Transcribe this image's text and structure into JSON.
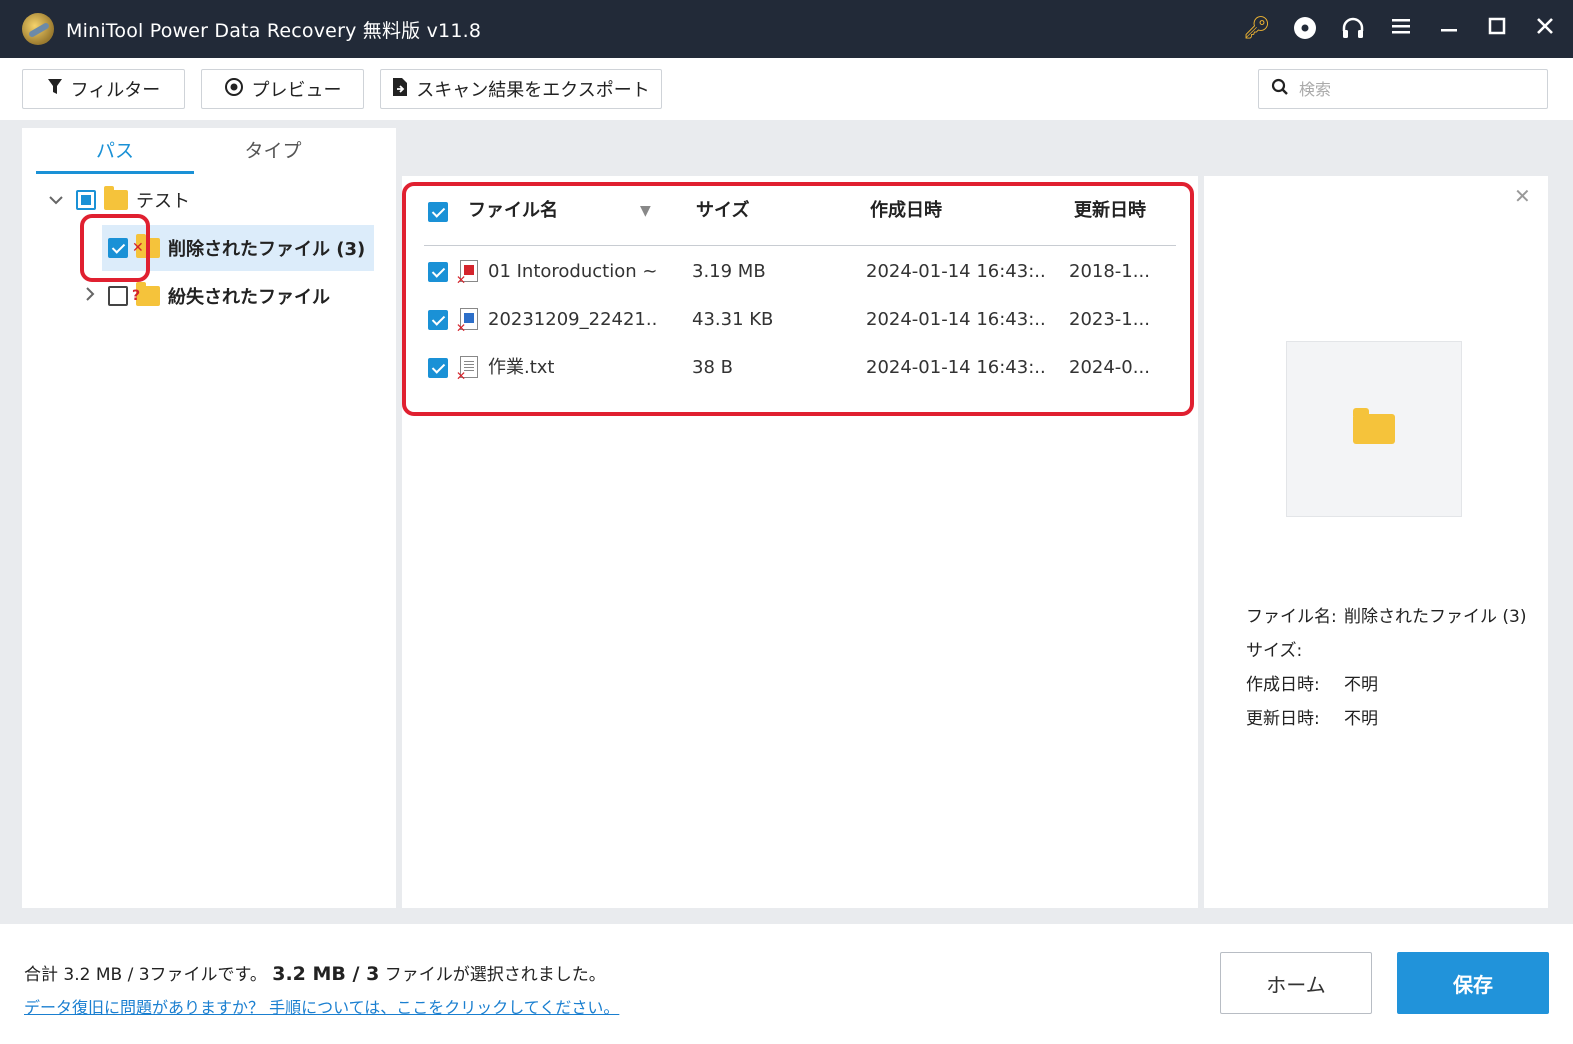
{
  "window": {
    "title": "MiniTool Power Data Recovery 無料版 v11.8"
  },
  "titlebar_icons": [
    "key-icon",
    "disc-icon",
    "headset-icon",
    "menu-icon",
    "minimize-icon",
    "maximize-icon",
    "close-icon"
  ],
  "toolbar": {
    "filter_label": "フィルター",
    "preview_label": "プレビュー",
    "export_label": "スキャン結果をエクスポート",
    "search_placeholder": "検索"
  },
  "tabs": [
    {
      "label": "パス",
      "active": true
    },
    {
      "label": "タイプ",
      "active": false
    }
  ],
  "tree": {
    "root": {
      "label": "テスト",
      "state": "partial",
      "expanded": true
    },
    "children": [
      {
        "label": "削除されたファイル (3)",
        "checked": true,
        "selected": true,
        "badge": "✕"
      },
      {
        "label": "紛失されたファイル",
        "checked": false,
        "selected": false,
        "badge": "?"
      }
    ]
  },
  "file_list": {
    "columns": [
      "ファイル名",
      "サイズ",
      "作成日時",
      "更新日時"
    ],
    "rows": [
      {
        "name": "01 Intoroduction ~...",
        "size": "3.19 MB",
        "created": "2024-01-14 16:43:...",
        "modified": "2018-1...",
        "icon_color": "#d4242c"
      },
      {
        "name": "20231209_22421...",
        "size": "43.31 KB",
        "created": "2024-01-14 16:43:...",
        "modified": "2023-1...",
        "icon_color": "#2d6fc9"
      },
      {
        "name": "作業.txt",
        "size": "38 B",
        "created": "2024-01-14 16:43:...",
        "modified": "2024-0...",
        "icon_color": "#888888"
      }
    ]
  },
  "details": {
    "name_key": "ファイル名:",
    "name_value": "削除されたファイル (3)",
    "size_key": "サイズ:",
    "size_value": "",
    "created_key": "作成日時:",
    "created_value": "不明",
    "modified_key": "更新日時:",
    "modified_value": "不明"
  },
  "footer": {
    "summary_pre": "合計 3.2 MB / 3ファイルです。",
    "summary_bold": "3.2 MB / 3",
    "summary_post": " ファイルが選択されました。",
    "help_link": "データ復旧に問題がありますか？ 手順については、ここをクリックしてください。",
    "home_label": "ホーム",
    "save_label": "保存"
  }
}
